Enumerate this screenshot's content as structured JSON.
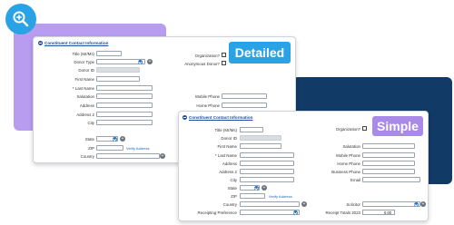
{
  "colors": {
    "accent_blue": "#2aa3e6",
    "accent_purple": "#b89cf0",
    "navy": "#123a66",
    "link": "#1d62c4"
  },
  "zoom_icon": "zoom-in-magnifier-icon",
  "detailed": {
    "badge": "Detailed",
    "section_title": "Constituent Contact Information",
    "labels": {
      "title": "Title (Mr/Ms)",
      "donor_type": "Donor Type",
      "donor_id": "Donor ID",
      "first_name": "First Name",
      "last_name": "* Last Name",
      "salutation": "Salutation",
      "address": "Address",
      "address2": "Address 2",
      "city": "City",
      "state": "State",
      "zip": "ZIP",
      "country": "Country",
      "organization": "Organization?",
      "anonymous": "Anonymous Donor?",
      "mobile_phone": "Mobile Phone",
      "home_phone": "Home Phone"
    },
    "verify_address": "Verify Address"
  },
  "simple": {
    "badge": "Simple",
    "section_title": "Constituent Contact Information",
    "labels": {
      "title": "Title (Mr/Ms)",
      "donor_id": "Donor ID",
      "first_name": "First Name",
      "last_name": "* Last Name",
      "address": "Address",
      "address2": "Address 2",
      "city": "City",
      "state": "State",
      "zip": "ZIP",
      "country": "Country",
      "receipting_preference": "Receipting Preference",
      "organization": "Organization?",
      "salutation": "Salutation",
      "mobile_phone": "Mobile Phone",
      "home_phone": "Home Phone",
      "business_phone": "Business Phone",
      "email": "Email",
      "solicitor": "Solicitor",
      "receipt_totals": "Receipt Totals 2023"
    },
    "verify_address": "Verify Address",
    "receipt_totals_value": "0.00"
  }
}
